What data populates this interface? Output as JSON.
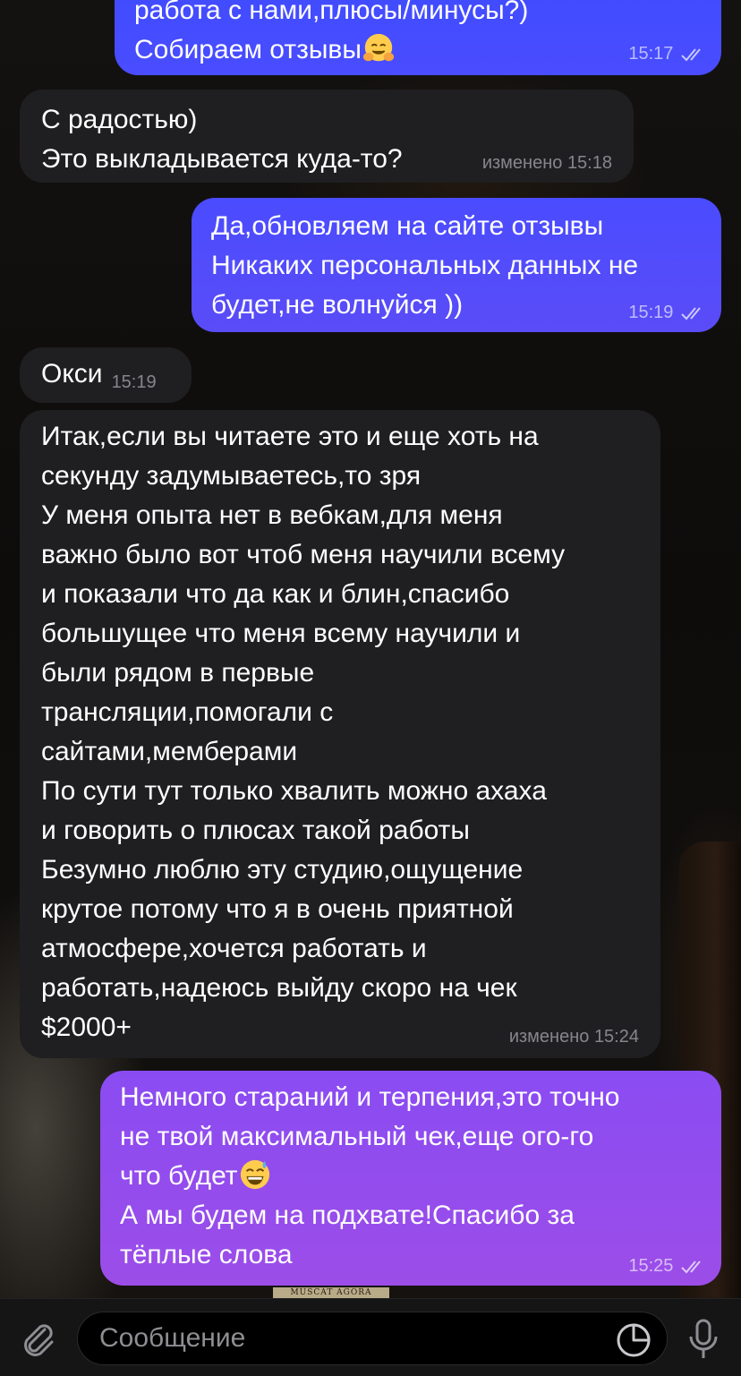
{
  "messages": [
    {
      "id": "m1",
      "direction": "out",
      "text": "работа с нами,плюсы/минусы?)\nСобираем отзывы",
      "emoji": "hugging-face",
      "time": "15:17",
      "status": "read"
    },
    {
      "id": "m2",
      "direction": "in",
      "text": "С радостью)\nЭто выкладывается куда-то?",
      "edited_label": "изменено",
      "time": "15:18"
    },
    {
      "id": "m3",
      "direction": "out",
      "text": "Да,обновляем на сайте отзывы\nНикаких персональных данных не\nбудет,не волнуйся ))",
      "time": "15:19",
      "status": "read"
    },
    {
      "id": "m4",
      "direction": "in",
      "text": "Окси",
      "time": "15:19"
    },
    {
      "id": "m5",
      "direction": "in",
      "text": "Итак,если вы читаете это и еще хоть на\nсекунду задумываетесь,то зря\nУ меня опыта нет в вебкам,для меня\nважно было вот чтоб меня научили всему\nи показали что да как и блин,спасибо\nбольшущее что меня всему научили и\nбыли рядом в первые\nтрансляции,помогали с\nсайтами,мемберами\nПо сути тут только хвалить можно ахаха\nи говорить о плюсах такой работы\nБезумно люблю эту студию,ощущение\nкрутое потому что я в очень приятной\nатмосфере,хочется работать и\nработать,надеюсь выйду скоро на чек\n$2000+",
      "edited_label": "изменено",
      "time": "15:24"
    },
    {
      "id": "m6",
      "direction": "out",
      "text_before_emoji": "Немного стараний и терпения,это точно\nне твой максимальный чек,еще ого-го\nчто будет",
      "emoji": "grinning-face-with-sweat",
      "text_after_emoji": "\nА мы будем на подхвате!Спасибо за\nтёплые слова",
      "time": "15:25",
      "status": "read"
    }
  ],
  "background": {
    "label_text": "MUSCAT AGORA"
  },
  "input": {
    "placeholder": "Сообщение"
  },
  "icons": {
    "attach": "paperclip-icon",
    "sticker": "sticker-icon",
    "voice": "microphone-icon",
    "read_ticks": "double-check-icon"
  },
  "colors": {
    "incoming_bubble": "#1f1f21",
    "outgoing_gradient_blue": "#3d5afe",
    "outgoing_gradient_violet": "#7c4dff",
    "outgoing_gradient_purple": "#9b4dea",
    "input_bar": "#151516",
    "icon_gray": "#8e8e93"
  }
}
